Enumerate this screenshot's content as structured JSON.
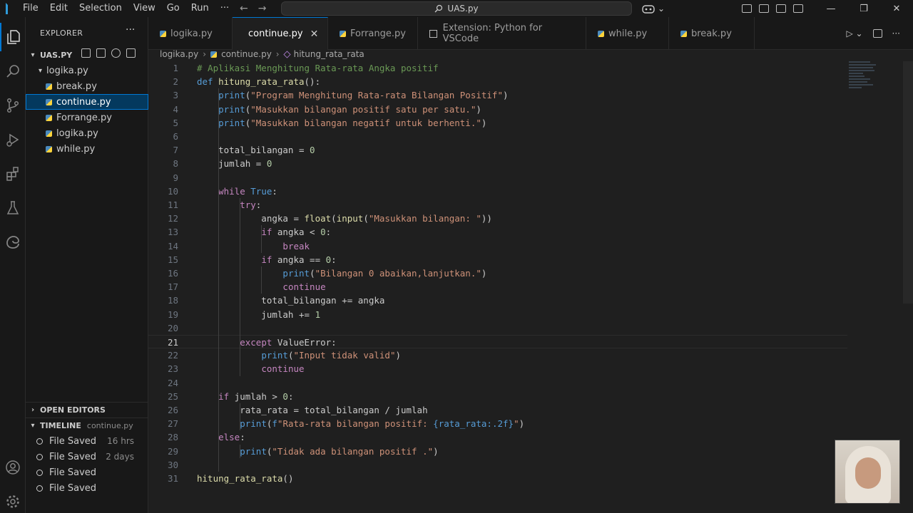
{
  "menu": [
    "File",
    "Edit",
    "Selection",
    "View",
    "Go",
    "Run",
    "···"
  ],
  "search_title": "UAS.py",
  "window_controls": [
    "—",
    "❐",
    "✕"
  ],
  "explorer": {
    "title": "EXPLORER",
    "more": "···",
    "folder": "UAS.PY",
    "tree": [
      "logika.py",
      "break.py",
      "continue.py",
      "Forrange.py",
      "logika.py",
      "while.py"
    ],
    "selected_index": 2
  },
  "open_editors": {
    "label": "OPEN EDITORS"
  },
  "timeline": {
    "label": "TIMELINE",
    "file": "continue.py",
    "entries": [
      {
        "label": "File Saved",
        "when": "16 hrs"
      },
      {
        "label": "File Saved",
        "when": "2 days"
      },
      {
        "label": "File Saved",
        "when": ""
      },
      {
        "label": "File Saved",
        "when": ""
      }
    ]
  },
  "tabs": [
    {
      "label": "logika.py",
      "active": false
    },
    {
      "label": "continue.py",
      "active": true
    },
    {
      "label": "Forrange.py",
      "active": false
    },
    {
      "label": "Extension: Python for VSCode",
      "active": false
    },
    {
      "label": "while.py",
      "active": false
    },
    {
      "label": "break.py",
      "active": false
    }
  ],
  "breadcrumb": [
    "logika.py",
    "continue.py",
    "hitung_rata_rata"
  ],
  "current_line": 21,
  "colors": {
    "keyword": "#c586c0",
    "builtin": "#569cd6",
    "string": "#ce9178",
    "comment": "#6a9955",
    "number": "#b5cea8",
    "function": "#dcdcaa",
    "variable": "#cccccc",
    "accent": "#0078d4"
  },
  "code": [
    [
      [
        "comment",
        "# Aplikasi Menghitung Rata-rata Angka positif"
      ]
    ],
    [
      [
        "builtin",
        "def "
      ],
      [
        "function",
        "hitung_rata_rata"
      ],
      [
        "variable",
        "():"
      ]
    ],
    [
      [
        "variable",
        "    "
      ],
      [
        "builtin",
        "print"
      ],
      [
        "variable",
        "("
      ],
      [
        "string",
        "\"Program Menghitung Rata-rata Bilangan Positif\""
      ],
      [
        "variable",
        ")"
      ]
    ],
    [
      [
        "variable",
        "    "
      ],
      [
        "builtin",
        "print"
      ],
      [
        "variable",
        "("
      ],
      [
        "string",
        "\"Masukkan bilangan positif satu per satu.\""
      ],
      [
        "variable",
        ")"
      ]
    ],
    [
      [
        "variable",
        "    "
      ],
      [
        "builtin",
        "print"
      ],
      [
        "variable",
        "("
      ],
      [
        "string",
        "\"Masukkan bilangan negatif untuk berhenti.\""
      ],
      [
        "variable",
        ")"
      ]
    ],
    [],
    [
      [
        "variable",
        "    total_bilangan = "
      ],
      [
        "number",
        "0"
      ]
    ],
    [
      [
        "variable",
        "    jumlah = "
      ],
      [
        "number",
        "0"
      ]
    ],
    [],
    [
      [
        "variable",
        "    "
      ],
      [
        "keyword",
        "while "
      ],
      [
        "builtin",
        "True"
      ],
      [
        "variable",
        ":"
      ]
    ],
    [
      [
        "variable",
        "        "
      ],
      [
        "keyword",
        "try"
      ],
      [
        "variable",
        ":"
      ]
    ],
    [
      [
        "variable",
        "            angka = "
      ],
      [
        "function",
        "float"
      ],
      [
        "variable",
        "("
      ],
      [
        "function",
        "input"
      ],
      [
        "variable",
        "("
      ],
      [
        "string",
        "\"Masukkan bilangan: \""
      ],
      [
        "variable",
        "))"
      ]
    ],
    [
      [
        "variable",
        "            "
      ],
      [
        "keyword",
        "if "
      ],
      [
        "variable",
        "angka < "
      ],
      [
        "number",
        "0"
      ],
      [
        "variable",
        ":"
      ]
    ],
    [
      [
        "variable",
        "                "
      ],
      [
        "keyword",
        "break"
      ]
    ],
    [
      [
        "variable",
        "            "
      ],
      [
        "keyword",
        "if "
      ],
      [
        "variable",
        "angka == "
      ],
      [
        "number",
        "0"
      ],
      [
        "variable",
        ":"
      ]
    ],
    [
      [
        "variable",
        "                "
      ],
      [
        "builtin",
        "print"
      ],
      [
        "variable",
        "("
      ],
      [
        "string",
        "\"Bilangan 0 abaikan,lanjutkan.\""
      ],
      [
        "variable",
        ")"
      ]
    ],
    [
      [
        "variable",
        "                "
      ],
      [
        "keyword",
        "continue"
      ]
    ],
    [
      [
        "variable",
        "            total_bilangan += angka"
      ]
    ],
    [
      [
        "variable",
        "            jumlah += "
      ],
      [
        "number",
        "1"
      ]
    ],
    [],
    [
      [
        "variable",
        "        "
      ],
      [
        "keyword",
        "except "
      ],
      [
        "variable",
        "ValueError:"
      ]
    ],
    [
      [
        "variable",
        "            "
      ],
      [
        "builtin",
        "print"
      ],
      [
        "variable",
        "("
      ],
      [
        "string",
        "\"Input tidak valid\""
      ],
      [
        "variable",
        ")"
      ]
    ],
    [
      [
        "variable",
        "            "
      ],
      [
        "keyword",
        "continue"
      ]
    ],
    [],
    [
      [
        "variable",
        "    "
      ],
      [
        "keyword",
        "if "
      ],
      [
        "variable",
        "jumlah > "
      ],
      [
        "number",
        "0"
      ],
      [
        "variable",
        ":"
      ]
    ],
    [
      [
        "variable",
        "        rata_rata = total_bilangan / jumlah"
      ]
    ],
    [
      [
        "variable",
        "        "
      ],
      [
        "builtin",
        "print"
      ],
      [
        "variable",
        "("
      ],
      [
        "builtin",
        "f"
      ],
      [
        "string",
        "\"Rata-rata bilangan positif: "
      ],
      [
        "builtin",
        "{rata_rata:.2f}"
      ],
      [
        "string",
        "\""
      ],
      [
        "variable",
        ")"
      ]
    ],
    [
      [
        "variable",
        "    "
      ],
      [
        "keyword",
        "else"
      ],
      [
        "variable",
        ":"
      ]
    ],
    [
      [
        "variable",
        "        "
      ],
      [
        "builtin",
        "print"
      ],
      [
        "variable",
        "("
      ],
      [
        "string",
        "\"Tidak ada bilangan positif .\""
      ],
      [
        "variable",
        ")"
      ]
    ],
    [],
    [
      [
        "function",
        "hitung_rata_rata"
      ],
      [
        "variable",
        "()"
      ]
    ]
  ]
}
